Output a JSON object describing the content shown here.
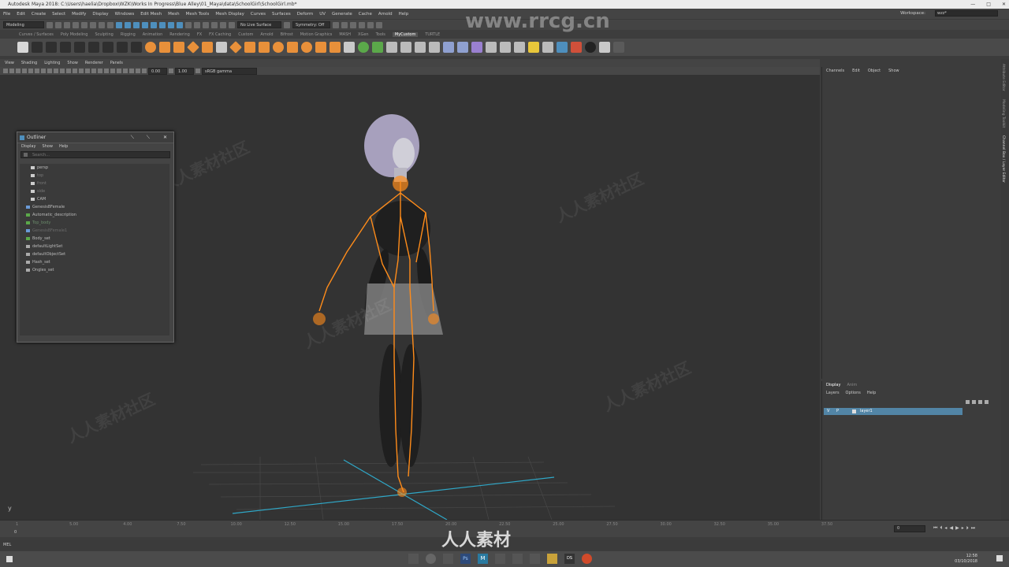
{
  "titlebar": {
    "text": "Autodesk Maya 2018: C:\\Users\\haelia\\Dropbox\\WZK\\Works In Progress\\Blue Alley\\01_Maya\\data\\SchoolGirl\\SchoolGirl.mb*"
  },
  "menubar": {
    "items": [
      "File",
      "Edit",
      "Create",
      "Select",
      "Modify",
      "Display",
      "Windows",
      "Edit Mesh",
      "Mesh",
      "Mesh Tools",
      "Mesh Display",
      "Curves",
      "Surfaces",
      "Deform",
      "UV",
      "Generate",
      "Cache",
      "Arnold",
      "Help"
    ],
    "workspace_label": "Workspace:",
    "workspace_value": "wzz*"
  },
  "statusline": {
    "mode": "Modeling",
    "live_surface": "No Live Surface",
    "symmetry": "Symmetry: Off"
  },
  "shelftabs": {
    "items": [
      "Curves / Surfaces",
      "Poly Modeling",
      "Sculpting",
      "Rigging",
      "Animation",
      "Rendering",
      "FX",
      "FX Caching",
      "Custom",
      "Arnold",
      "Bifrost",
      "Motion Graphics",
      "MASH",
      "XGen",
      "Tools",
      "MyCustom",
      "TURTLE"
    ],
    "active": "MyCustom"
  },
  "panelmenu": {
    "items": [
      "View",
      "Shading",
      "Lighting",
      "Show",
      "Renderer",
      "Panels"
    ]
  },
  "paneltools": {
    "field1": "0.00",
    "field2": "1.00",
    "colorspace": "sRGB gamma"
  },
  "channelbox": {
    "menu": [
      "Channels",
      "Edit",
      "Object",
      "Show"
    ]
  },
  "layerpanel": {
    "tabs": [
      "Display",
      "Anim"
    ],
    "active_tab": "Display",
    "menu": [
      "Layers",
      "Options",
      "Help"
    ],
    "layer": {
      "v": "V",
      "p": "P",
      "name": "layer1"
    }
  },
  "sidetabs": [
    "Attribute Editor",
    "Modeling Toolkit",
    "Channel Box / Layer Editor"
  ],
  "outliner": {
    "title": "Outliner",
    "menu": [
      "Display",
      "Show",
      "Help"
    ],
    "search_placeholder": "Search...",
    "items": [
      {
        "label": "persp",
        "kind": "camera",
        "color": "#bbbbbb"
      },
      {
        "label": "top",
        "kind": "camera",
        "color": "#777777"
      },
      {
        "label": "front",
        "kind": "camera",
        "color": "#777777"
      },
      {
        "label": "side",
        "kind": "camera",
        "color": "#777777"
      },
      {
        "label": "CAM",
        "kind": "camera",
        "color": "#bbbbbb"
      },
      {
        "label": "Genesis8Female",
        "kind": "joint",
        "color": "#bbbbbb"
      },
      {
        "label": "Automatic_description",
        "kind": "set",
        "color": "#bbbbbb"
      },
      {
        "label": "Top_body",
        "kind": "set",
        "color": "#6a8a6a"
      },
      {
        "label": "Genesis8Female1",
        "kind": "joint",
        "color": "#6a6a6a"
      },
      {
        "label": "Body_set",
        "kind": "set",
        "color": "#bbbbbb"
      },
      {
        "label": "defaultLightSet",
        "kind": "lightset",
        "color": "#bbbbbb"
      },
      {
        "label": "defaultObjectSet",
        "kind": "lightset",
        "color": "#bbbbbb"
      },
      {
        "label": "Hash_set",
        "kind": "lightset",
        "color": "#bbbbbb"
      },
      {
        "label": "Ongles_set",
        "kind": "lightset",
        "color": "#bbbbbb"
      }
    ]
  },
  "timeline": {
    "ticks": [
      "1",
      "5.00",
      "4.00",
      "7.50",
      "10.00",
      "12.50",
      "15.00",
      "17.50",
      "20.00",
      "22.50",
      "25.00",
      "27.50",
      "30.00",
      "32.50",
      "35.00",
      "37.50"
    ],
    "current": "0"
  },
  "cmdline": {
    "label": "MEL"
  },
  "taskbar": {
    "time": "12:58",
    "date": "03/10/2018"
  },
  "watermark": {
    "site": "www.rrcg.cn",
    "cn": "人人素材社区",
    "logo_text": "人人素材"
  },
  "colors": {
    "accent": "#5285a6",
    "rig": "#ff8c1a",
    "grid_axis": "#2fa8c8"
  }
}
